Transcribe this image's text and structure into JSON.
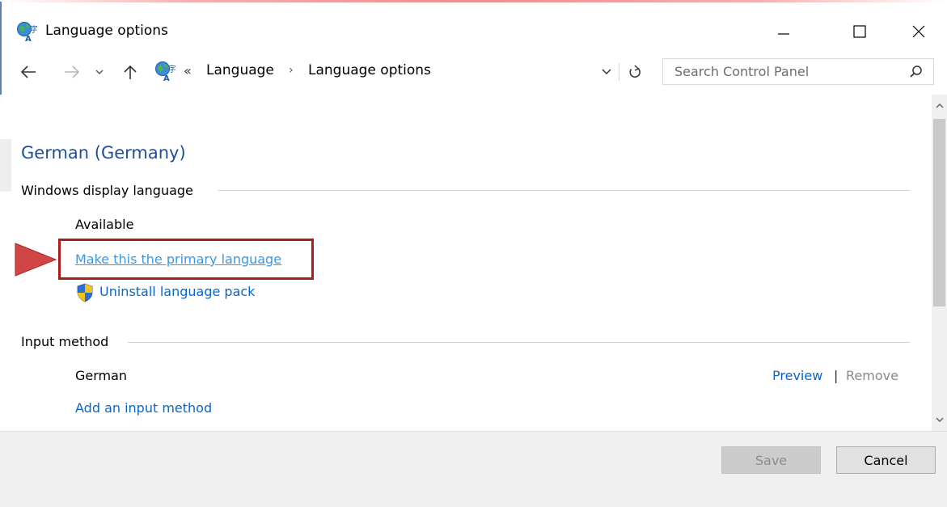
{
  "window": {
    "title": "Language options",
    "title_icon": "language-globe-icon"
  },
  "titlebar_controls": {
    "minimize_icon": "minimize-icon",
    "maximize_icon": "maximize-icon",
    "close_icon": "close-icon"
  },
  "navigation": {
    "overflow": "«",
    "separator": "›",
    "breadcrumbs": [
      {
        "label": "Language"
      },
      {
        "label": "Language options"
      }
    ]
  },
  "search": {
    "placeholder": "Search Control Panel"
  },
  "content": {
    "language_name": "German (Germany)",
    "display_section": {
      "label": "Windows display language",
      "status": "Available",
      "primary_link": "Make this the primary language",
      "uninstall_link": "Uninstall language pack"
    },
    "input_section": {
      "label": "Input method",
      "methods": [
        {
          "name": "German",
          "preview": "Preview",
          "remove": "Remove"
        }
      ],
      "pipe": "|",
      "add_link": "Add an input method"
    }
  },
  "footer": {
    "save_label": "Save",
    "cancel_label": "Cancel"
  },
  "colors": {
    "link": "#0a66c8",
    "heading": "#1e4e9f",
    "highlight": "#b01b1b",
    "arrow": "#d24545"
  }
}
